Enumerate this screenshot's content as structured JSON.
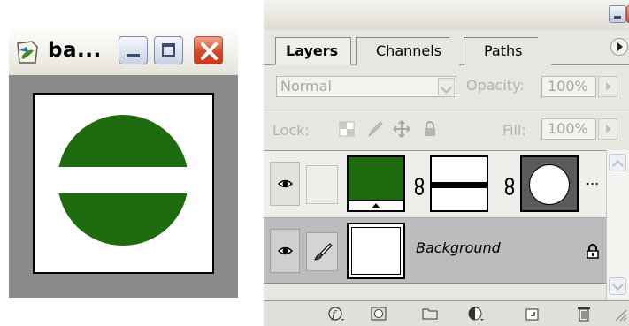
{
  "document_window": {
    "title": "ba...",
    "colors": {
      "fill": "#1f6b10",
      "frame": "#8b8b8b",
      "close_button": "#d6472b"
    }
  },
  "palette": {
    "tabs": [
      {
        "label": "Layers",
        "active": true
      },
      {
        "label": "Channels",
        "active": false
      },
      {
        "label": "Paths",
        "active": false
      }
    ],
    "blend_mode": "Normal",
    "opacity_label": "Opacity:",
    "opacity_value": "100%",
    "lock_label": "Lock:",
    "fill_label": "Fill:",
    "fill_value": "100%",
    "layers": [
      {
        "name": "",
        "visible": true,
        "selected": false,
        "has_layer_mask": true,
        "has_vector_mask": true,
        "overflow": "..."
      },
      {
        "name": "Background",
        "visible": true,
        "selected": true,
        "locked": true
      }
    ],
    "bottom_icons": [
      "layer-style-icon",
      "add-mask-icon",
      "new-group-icon",
      "adjustment-layer-icon",
      "new-layer-icon",
      "trash-icon"
    ]
  }
}
